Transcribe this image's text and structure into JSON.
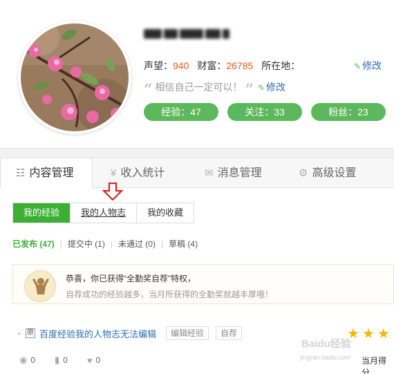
{
  "profile": {
    "username": "",
    "reputation_label": "声望：",
    "reputation_value": "940",
    "wealth_label": "财富：",
    "wealth_value": "26785",
    "location_label": "所在地：",
    "edit_label": "修改",
    "motto": "相信自己一定可以！",
    "motto_edit_label": "修改",
    "pills": {
      "experience": "经验：47",
      "follow": "关注：33",
      "fans": "粉丝：23"
    },
    "accent_color": "#5cb85c"
  },
  "tabs": [
    {
      "label": "内容管理",
      "icon": "list-icon",
      "active": true
    },
    {
      "label": "收入统计",
      "icon": "yen-icon",
      "active": false
    },
    {
      "label": "消息管理",
      "icon": "mail-icon",
      "active": false
    },
    {
      "label": "高级设置",
      "icon": "gear-icon",
      "active": false
    }
  ],
  "subtabs": [
    {
      "label": "我的经验",
      "active": true
    },
    {
      "label": "我的人物志",
      "active": false
    },
    {
      "label": "我的收藏",
      "active": false
    }
  ],
  "filters": [
    {
      "label": "已发布 (47)",
      "active": true
    },
    {
      "label": "提交中 (1)",
      "active": false
    },
    {
      "label": "未通过 (0)",
      "active": false
    },
    {
      "label": "草稿 (4)",
      "active": false
    }
  ],
  "notice": {
    "title": "恭喜，你已获得“全勤奖自荐”特权，",
    "subtitle": "自荐成功的经验越多，当月所获得的全勤奖就越丰厚哦！"
  },
  "item": {
    "badge": "原",
    "title": "百度经验我的人物志无法编辑",
    "edit_tag": "编辑经验",
    "self_tag": "自荐",
    "stars": 3,
    "month_label": "当月得分"
  },
  "meta": {
    "views": "0",
    "votes": "0",
    "likes": "0"
  },
  "watermark": {
    "text": "Baidu经验",
    "url": "jingyan.baidu.com"
  }
}
